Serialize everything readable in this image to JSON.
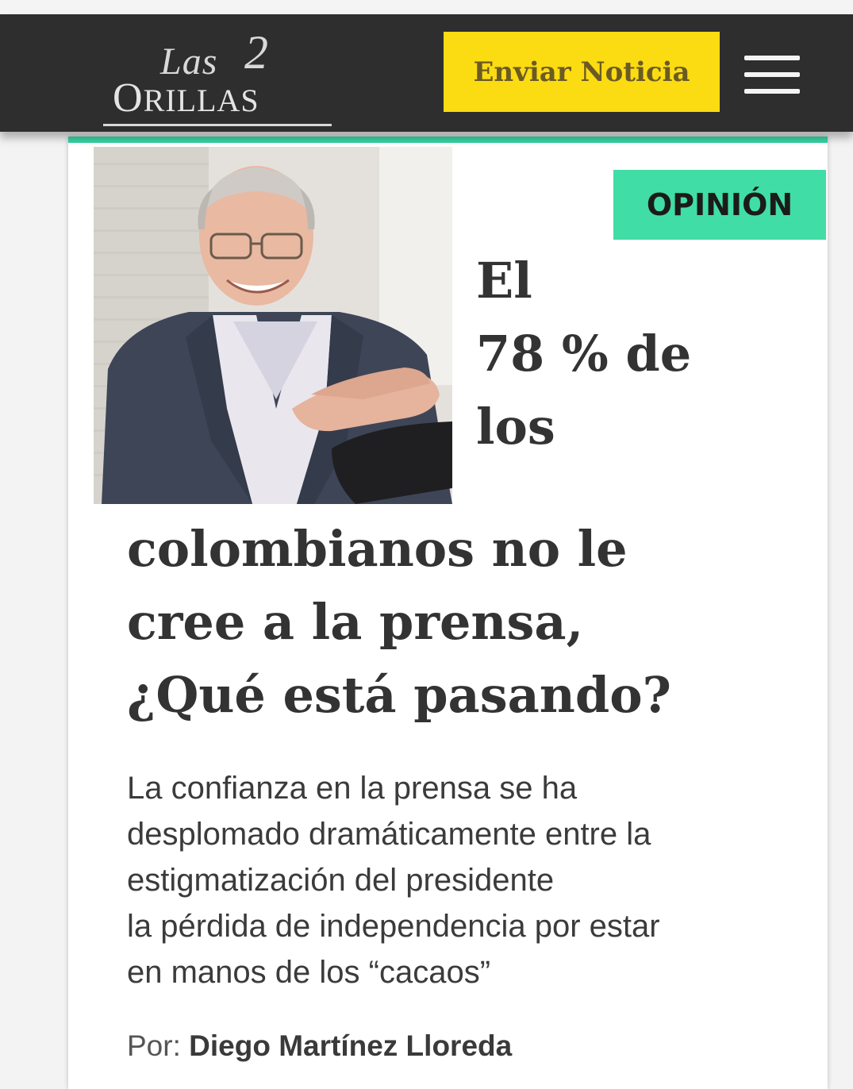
{
  "header": {
    "logo": {
      "las": "Las",
      "two": "2",
      "orillas_first": "O",
      "orillas_rest": "RILLAS"
    },
    "send_news_label": "Enviar Noticia",
    "menu_icon": "hamburger-menu-icon",
    "colors": {
      "background": "#2e2e2e",
      "button": "#fbdb12",
      "button_text": "#6a5b24"
    }
  },
  "article": {
    "category": "OPINIÓN",
    "title_lines": [
      "El",
      "78 % de",
      "los",
      "colombianos no le",
      "cree a la prensa,",
      "¿Qué está pasando?"
    ],
    "summary_lines": [
      "La confianza en la prensa se ha",
      "desplomado dramáticamente entre la",
      "estigmatización del presidente",
      "la pérdida de independencia por estar",
      "en manos de los “cacaos”"
    ],
    "byline": {
      "prefix": "Por:",
      "author": "Diego Martínez Lloreda"
    },
    "colors": {
      "accent": "#41dda6",
      "rule": "#38d4a4",
      "title": "#333333"
    }
  }
}
